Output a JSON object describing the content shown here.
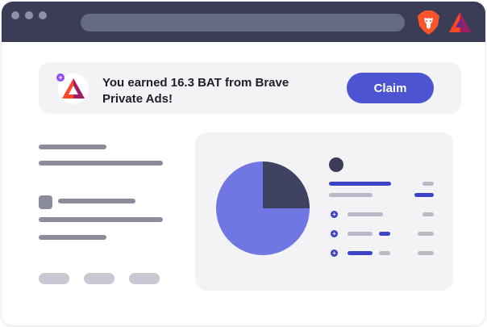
{
  "colors": {
    "chrome": "#3b3d57",
    "accent": "#4c54d2",
    "pie_main": "#7077e3",
    "pie_slice": "#3f4161"
  },
  "browser": {
    "icons": [
      "brave-lion-icon",
      "bat-triangle-icon"
    ]
  },
  "notification": {
    "message": "You earned 16.3 BAT from Brave Private Ads!",
    "claim_label": "Claim",
    "icon": "bat-triangle-icon"
  },
  "chart_data": {
    "type": "pie",
    "values": [
      75,
      25
    ]
  }
}
